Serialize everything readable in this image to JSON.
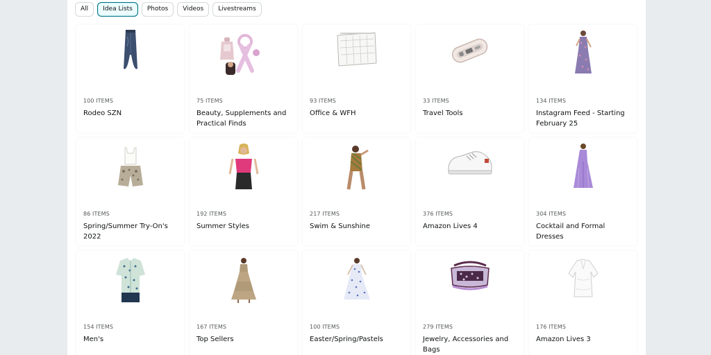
{
  "filters": {
    "all": "All",
    "idea_lists": "Idea Lists",
    "photos": "Photos",
    "videos": "Videos",
    "livestreams": "Livestreams",
    "active": "Idea Lists"
  },
  "cards": [
    {
      "count": "100 ITEMS",
      "title": "Rodeo SZN",
      "icon": "denim-skirt-icon"
    },
    {
      "count": "75 ITEMS",
      "title": "Beauty, Supplements and Practical Finds",
      "icon": "beauty-products-icon"
    },
    {
      "count": "93 ITEMS",
      "title": "Office & WFH",
      "icon": "wall-calendar-icon"
    },
    {
      "count": "33 ITEMS",
      "title": "Travel Tools",
      "icon": "travel-case-icon"
    },
    {
      "count": "134 ITEMS",
      "title": "Instagram Feed - Starting February 25",
      "icon": "floral-dress-icon"
    },
    {
      "count": "86 ITEMS",
      "title": "Spring/Summer Try-On's 2022",
      "icon": "top-and-shorts-icon"
    },
    {
      "count": "192 ITEMS",
      "title": "Summer Styles",
      "icon": "pink-top-icon"
    },
    {
      "count": "217 ITEMS",
      "title": "Swim & Sunshine",
      "icon": "swimsuit-icon"
    },
    {
      "count": "376 ITEMS",
      "title": "Amazon Lives 4",
      "icon": "sneaker-icon"
    },
    {
      "count": "304 ITEMS",
      "title": "Cocktail and Formal Dresses",
      "icon": "formal-gown-icon"
    },
    {
      "count": "154 ITEMS",
      "title": "Men's",
      "icon": "mens-shirt-icon"
    },
    {
      "count": "167 ITEMS",
      "title": "Top Sellers",
      "icon": "tiered-dress-icon"
    },
    {
      "count": "100 ITEMS",
      "title": "Easter/Spring/Pastels",
      "icon": "blue-dress-icon"
    },
    {
      "count": "279 ITEMS",
      "title": "Jewelry, Accessories and Bags",
      "icon": "handbag-icon"
    },
    {
      "count": "176 ITEMS",
      "title": "Amazon Lives 3",
      "icon": "white-coverup-icon"
    }
  ],
  "colors": {
    "active_chip_border": "#007185",
    "chip_border": "#d5d9d9",
    "page_bg": "#e8ecef",
    "count_text": "#565959"
  }
}
